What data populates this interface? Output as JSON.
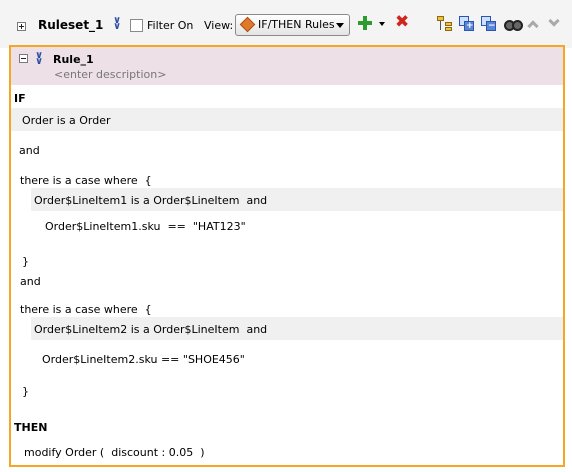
{
  "toolbar": {
    "ruleset_name": "Ruleset_1",
    "filter_label": "Filter On",
    "view_label": "View:",
    "view_value": "IF/THEN Rules",
    "icons": [
      "expand-icon",
      "collapse-all-icon",
      "add-icon",
      "dropdown-arrow-icon",
      "delete-icon",
      "tree-icon",
      "add-rule-icon",
      "copy-rule-icon",
      "find-icon",
      "move-up-icon",
      "move-down-icon"
    ]
  },
  "rule": {
    "name": "Rule_1",
    "description": "<enter description>",
    "if_keyword": "IF",
    "lines": [
      "Order is a Order",
      "and",
      "there is a case where  {",
      "Order$LineItem1 is a Order$LineItem  and",
      "Order$LineItem1.sku  ==  \"HAT123\"",
      "}",
      "and",
      "there is a case where  {",
      "Order$LineItem2 is a Order$LineItem  and",
      "Order$LineItem2.sku == \"SHOE456\"",
      "}"
    ],
    "then_keyword": "THEN",
    "action": "modify Order (  discount : 0.05  )"
  },
  "colors": {
    "panel_border": "#f5a623",
    "rule_header_bg": "#ede0e6",
    "band_bg": "#f0f0f0",
    "add_green": "#2e9b2e",
    "delete_red": "#d0251c",
    "chevron_blue": "#2c4fa3"
  }
}
